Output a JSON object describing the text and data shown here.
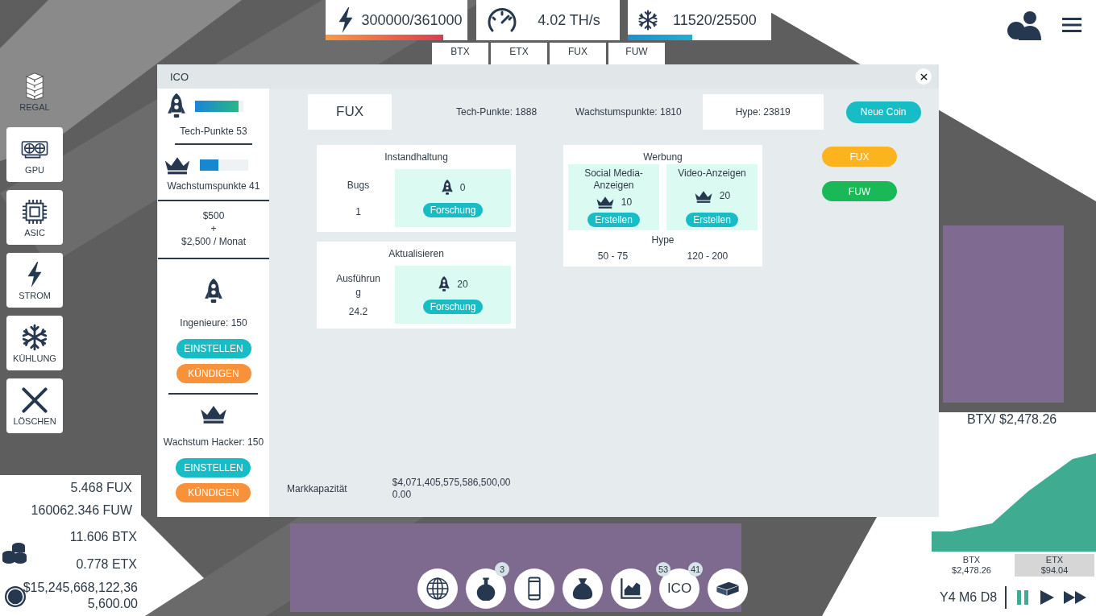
{
  "resources": [
    {
      "kind": "power",
      "value": "300000/361000",
      "level": 0.83
    },
    {
      "kind": "hashrate",
      "value": "4.02 TH/s"
    },
    {
      "kind": "cooling",
      "value": "11520/25500",
      "level": 0.45
    }
  ],
  "hashrate_coins": [
    "BTX",
    "ETX",
    "FUX",
    "FUW"
  ],
  "tools": [
    {
      "kind": "shelf",
      "label": "REGAL",
      "selected": true
    },
    {
      "kind": "gpu",
      "label": "GPU",
      "selected": false
    },
    {
      "kind": "chip",
      "label": "ASIC",
      "selected": false
    },
    {
      "kind": "bolt",
      "label": "STROM",
      "selected": false
    },
    {
      "kind": "snow",
      "label": "KÜHLUNG",
      "selected": false
    },
    {
      "kind": "cross",
      "label": "LÖSCHEN",
      "selected": false
    }
  ],
  "dialog": {
    "title": "ICO",
    "team": {
      "points": [
        {
          "kind": "rocket",
          "label": "Tech-Punkte 53",
          "level": 0.9
        },
        {
          "kind": "crown",
          "label": "Wachstumspunkte 41",
          "level": 0.38
        }
      ],
      "cost": [
        "$500",
        "+",
        "$2,500 / Monat"
      ],
      "staff": [
        {
          "kind": "rocket",
          "label": "Ingenieure: 150",
          "hire": "EINSTELLEN",
          "fire": "KÜNDIGEN"
        },
        {
          "kind": "crown",
          "label": "Wachstum Hacker: 150",
          "hire": "EINSTELLEN",
          "fire": "KÜNDIGEN"
        }
      ]
    },
    "coin": "FUX",
    "stats": [
      "Tech-Punkte: 1888",
      "Wachstumspunkte: 1810"
    ],
    "hype": "Hype: 23819",
    "new_coin": "Neue Coin",
    "upgrades": [
      {
        "title": "Instandhaltung",
        "stat_label": "Bugs",
        "stat_value": "1",
        "cost": "0",
        "button": "Forschung"
      },
      {
        "title": "Aktualisieren",
        "stat_label": "Ausführung",
        "stat_value": "24.2",
        "cost": "20",
        "button": "Forschung"
      }
    ],
    "ads": {
      "title": "Werbung",
      "hype_label": "Hype",
      "options": [
        {
          "name": "Social Media-Anzeigen",
          "cost": "10",
          "button": "Erstellen",
          "hype": "50 - 75"
        },
        {
          "name": "Video-Anzeigen",
          "cost": "20",
          "button": "Erstellen",
          "hype": "120 - 200"
        }
      ]
    },
    "coins": [
      {
        "label": "FUX",
        "color": "#fbb41e"
      },
      {
        "label": "FUW",
        "color": "#1ab957"
      }
    ],
    "market_cap": {
      "label": "Markkapazität",
      "value": "$4,071,405,575,586,500,000.00"
    }
  },
  "balances": [
    {
      "kind": "boxed",
      "text": "5.468 FUX"
    },
    {
      "kind": "boxed",
      "text": "160062.346 FUW"
    },
    {
      "kind": "plain",
      "text": "11.606 BTX"
    },
    {
      "kind": "plain",
      "text": "0.778 ETX"
    }
  ],
  "cash": "$15,245,668,122,365,600.00",
  "market": {
    "title": "BTX/ $2,478.26",
    "tabs": [
      {
        "coin": "BTX",
        "price": "$2,478.26",
        "selected": true
      },
      {
        "coin": "ETX",
        "price": "$94.04",
        "selected": false
      }
    ]
  },
  "clock": {
    "date": "Y4 M6 D8",
    "controls": [
      {
        "kind": "pause",
        "selected": true
      },
      {
        "kind": "play",
        "selected": false
      },
      {
        "kind": "fast",
        "selected": false
      }
    ]
  },
  "nav": [
    {
      "kind": "globe"
    },
    {
      "kind": "flask",
      "badges": [
        "3"
      ]
    },
    {
      "kind": "phone"
    },
    {
      "kind": "bag"
    },
    {
      "kind": "chart"
    },
    {
      "kind": "text",
      "label": "ICO",
      "badges": [
        "53",
        "41"
      ]
    },
    {
      "kind": "warehouse"
    }
  ]
}
